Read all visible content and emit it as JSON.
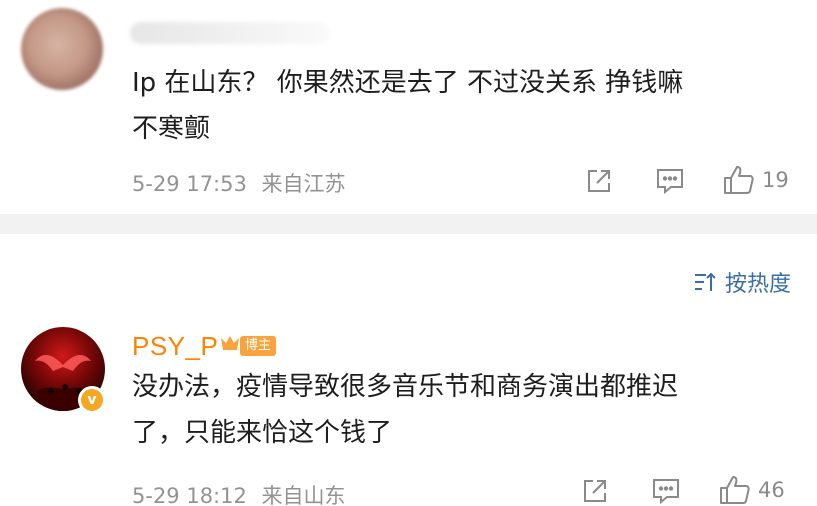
{
  "comments": [
    {
      "text_line1": "Ip 在山东？ 你果然还是去了 不过没关系 挣钱嘛",
      "text_line2": "不寒颤",
      "date": "5-29 17:53",
      "location": "来自江苏",
      "likes": "19"
    },
    {
      "username": "PSY_P",
      "badge": "博主",
      "text_line1": "没办法，疫情导致很多音乐节和商务演出都推迟",
      "text_line2": "了，只能来恰这个钱了",
      "date": "5-29 18:12",
      "location": "来自山东",
      "likes": "46"
    }
  ],
  "sort": {
    "label": "按热度"
  },
  "colors": {
    "username": "#ff8200",
    "link": "#3a6ea5",
    "meta": "#939393",
    "badge": "#f7a43c"
  },
  "icons": [
    "share-icon",
    "comment-icon",
    "thumbs-up-icon",
    "sort-icon",
    "crown-icon",
    "verified-icon"
  ]
}
